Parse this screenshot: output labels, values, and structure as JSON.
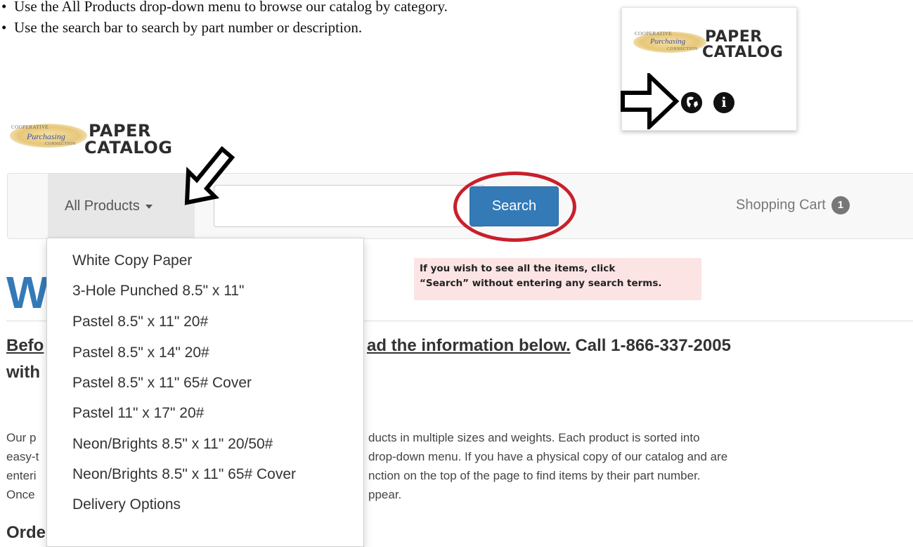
{
  "instructions": {
    "bullets": [
      "Use the All Products drop-down menu to browse our catalog by category.",
      "Use the search bar to search by part number or description."
    ],
    "bullet_char": "•"
  },
  "logo": {
    "line1": "PAPER",
    "line2": "CATALOG",
    "tag_top": "COOPERATIVE",
    "tag_script": "Purchasing",
    "tag_bottom": "CONNECTION"
  },
  "callout": {
    "icons": [
      "globe-icon",
      "info-icon"
    ],
    "info_glyph": "i"
  },
  "navbar": {
    "dropdown_label": "All Products",
    "search_placeholder": "",
    "search_button": "Search",
    "cart_label": "Shopping Cart",
    "cart_count": "1"
  },
  "menu": {
    "items": [
      "White Copy Paper",
      "3-Hole Punched 8.5\" x 11\"",
      "Pastel 8.5\" x 11\" 20#",
      "Pastel 8.5\" x 14\" 20#",
      "Pastel 8.5\" x 11\" 65# Cover",
      "Pastel 11\" x 17\" 20#",
      "Neon/Brights 8.5\" x 11\" 20/50#",
      "Neon/Brights 8.5\" x 11\" 65# Cover",
      "Delivery Options"
    ]
  },
  "note": {
    "line1": "If you wish to see all the items, click",
    "line2": "“Search” without entering any search terms."
  },
  "content": {
    "big_letter": "W",
    "heading_part1": "Befo",
    "heading_underlined": "ad the information below.",
    "heading_part2": " Call 1-866-337-2005",
    "heading_line2": "with",
    "para_lines": [
      [
        "Our p",
        "ducts in multiple sizes and weights. Each product is sorted into"
      ],
      [
        "easy-t",
        "drop-down menu. If you have a physical copy of our catalog and are"
      ],
      [
        "enteri",
        "nction on the top of the page to find items by their part number."
      ],
      [
        "Once",
        "ppear."
      ]
    ],
    "order_heading": "Orde"
  },
  "colors": {
    "primary_button": "#337ab7",
    "highlight_ellipse": "#c8202b",
    "note_background": "#fce4e4"
  }
}
